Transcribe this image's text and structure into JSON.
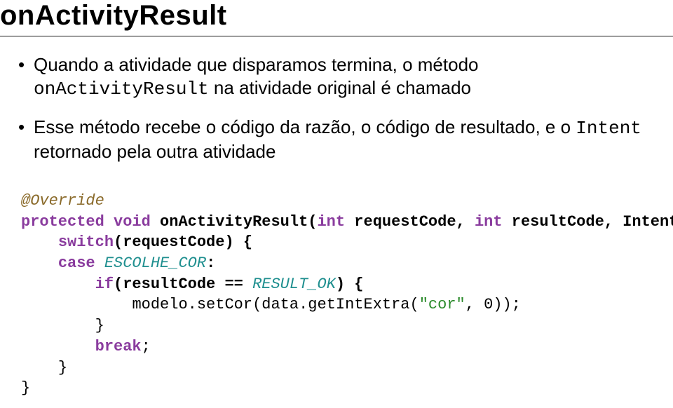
{
  "title": "onActivityResult",
  "bullets": [
    {
      "pre": "Quando a atividade que disparamos termina, o método ",
      "mono": "onActivityResult",
      "post": " na atividade original é chamado"
    },
    {
      "pre": "Esse método recebe o código da razão, o código de resultado, e o ",
      "mono": "Intent",
      "post": " retornado pela outra atividade"
    }
  ],
  "code": {
    "l1_anno": "@Override",
    "l2_kw1": "protected",
    "l2_kw2": "void",
    "l2_name": "onActivityResult(",
    "l2_kw3": "int",
    "l2_arg1": " requestCode, ",
    "l2_kw4": "int",
    "l2_arg2": " resultCode, Intent data) {",
    "l3_kw": "switch",
    "l3_rest": "(requestCode) {",
    "l4_kw": "case",
    "l4_const": " ESCOLHE_COR",
    "l4_colon": ":",
    "l5_kw": "if",
    "l5_open": "(resultCode == ",
    "l5_const": "RESULT_OK",
    "l5_close": ") {",
    "l6_call": "modelo.setCor(data.getIntExtra(",
    "l6_str": "\"cor\"",
    "l6_after": ", 0));",
    "l7_brace": "}",
    "l8_kw": "break",
    "l8_semi": ";",
    "l9_brace": "}",
    "l10_brace": "}"
  }
}
